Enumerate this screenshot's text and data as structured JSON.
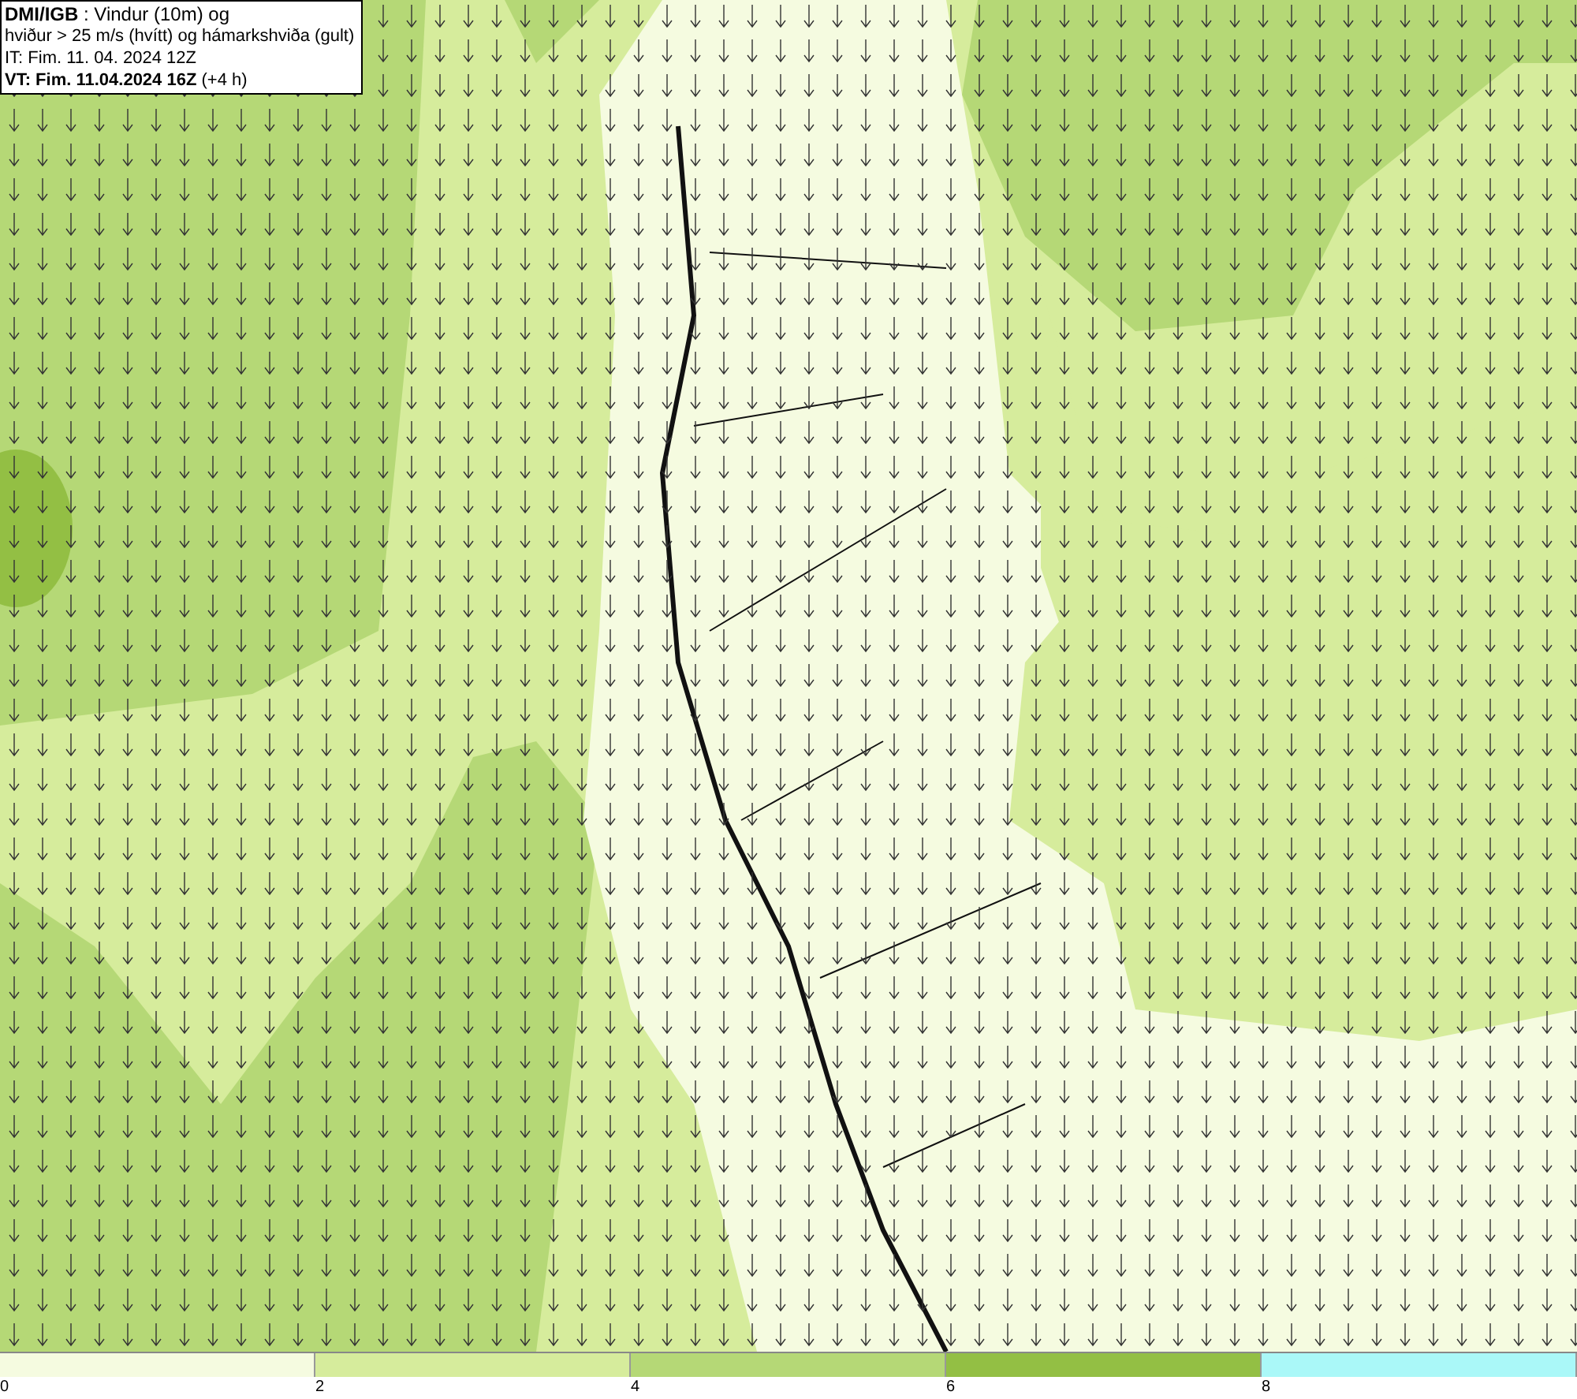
{
  "legend": {
    "lines": [
      "**DMI/IGB** : Vindur (10m) og",
      "hviður > 25 m/s (hvítt) og hámarkshviða (gult)",
      "IT: Fim. 11. 04. 2024 12Z",
      "**VT: Fim. 11.04.2024 16Z** (+4 h)"
    ]
  },
  "colorbar": {
    "segments": [
      {
        "label": "0",
        "color": "#f5fbe0"
      },
      {
        "label": "2",
        "color": "#d6ec9c"
      },
      {
        "label": "4",
        "color": "#b5d876"
      },
      {
        "label": "6",
        "color": "#93bf44"
      },
      {
        "label": "8",
        "color": "#aaf8f8"
      }
    ]
  }
}
